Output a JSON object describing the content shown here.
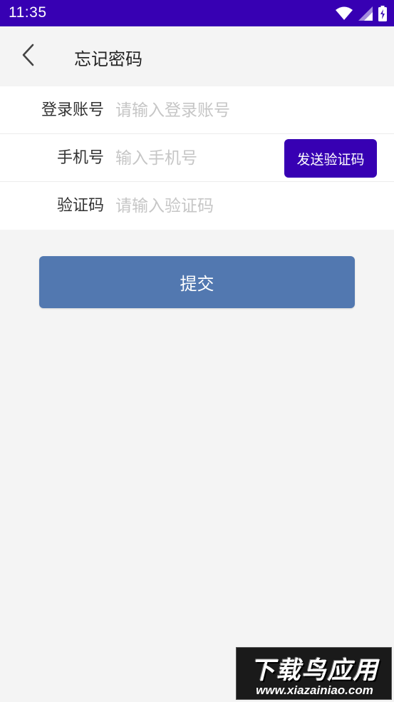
{
  "status_bar": {
    "time": "11:35",
    "icons": [
      "wifi-icon",
      "signal-icon",
      "battery-charging-icon"
    ],
    "color": "#3700b3"
  },
  "toolbar": {
    "back_icon": "chevron-left-icon",
    "title": "忘记密码"
  },
  "form": {
    "account": {
      "label": "登录账号",
      "placeholder": "请输入登录账号"
    },
    "phone": {
      "label": "手机号",
      "placeholder": "输入手机号"
    },
    "send_code_label": "发送验证码",
    "code": {
      "label": "验证码",
      "placeholder": "请输入验证码"
    }
  },
  "submit_label": "提交",
  "colors": {
    "accent": "#3700b3",
    "submit": "#5278b0",
    "background": "#f4f4f4",
    "placeholder": "#c6c6c6"
  },
  "watermark": {
    "title": "下载鸟应用",
    "url": "www.xiazainiao.com"
  }
}
